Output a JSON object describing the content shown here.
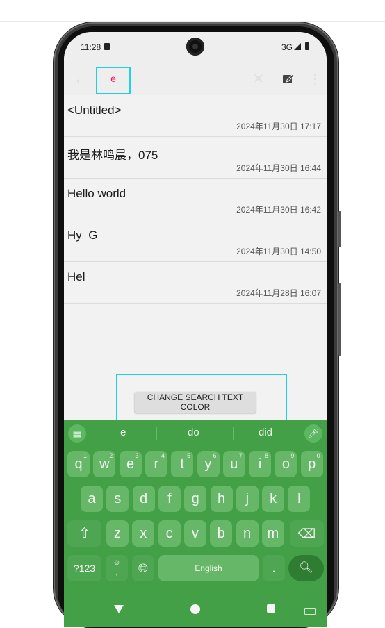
{
  "status_bar": {
    "time": "11:28",
    "network": "3G"
  },
  "toolbar": {
    "search_value": "e"
  },
  "notes": [
    {
      "title": "<Untitled>",
      "date": "2024年11月30日 17:17"
    },
    {
      "title": "我是林鸣晨，075",
      "date": "2024年11月30日 16:44"
    },
    {
      "title": "Hello world",
      "date": "2024年11月30日 16:42"
    },
    {
      "title": "Hy  G",
      "date": "2024年11月30日 14:50"
    },
    {
      "title": "Hel",
      "date": "2024年11月28日 16:07"
    }
  ],
  "change_button": {
    "label": "CHANGE SEARCH TEXT COLOR"
  },
  "keyboard": {
    "suggestions": [
      "e",
      "do",
      "did"
    ],
    "row1": [
      {
        "k": "q",
        "s": "1"
      },
      {
        "k": "w",
        "s": "2"
      },
      {
        "k": "e",
        "s": "3"
      },
      {
        "k": "r",
        "s": "4"
      },
      {
        "k": "t",
        "s": "5"
      },
      {
        "k": "y",
        "s": "6"
      },
      {
        "k": "u",
        "s": "7"
      },
      {
        "k": "i",
        "s": "8"
      },
      {
        "k": "o",
        "s": "9"
      },
      {
        "k": "p",
        "s": "0"
      }
    ],
    "row2": [
      "a",
      "s",
      "d",
      "f",
      "g",
      "h",
      "j",
      "k",
      "l"
    ],
    "row3": [
      "z",
      "x",
      "c",
      "v",
      "b",
      "n",
      "m"
    ],
    "symbols_label": "?123",
    "comma_label": ",",
    "emoji_label": "☺",
    "space_label": "English",
    "period_label": "."
  },
  "colors": {
    "search_text": "#e0245e",
    "highlight_box": "#1fd0e8",
    "keyboard_bg": "#43a047"
  },
  "icons": {
    "back": "arrow-left-icon",
    "clear": "close-icon",
    "edit": "edit-note-icon",
    "more": "more-vert-icon",
    "apps": "apps-grid-icon",
    "mic": "mic-icon",
    "shift": "shift-icon",
    "delete": "backspace-icon",
    "globe": "globe-icon",
    "search": "search-icon"
  }
}
